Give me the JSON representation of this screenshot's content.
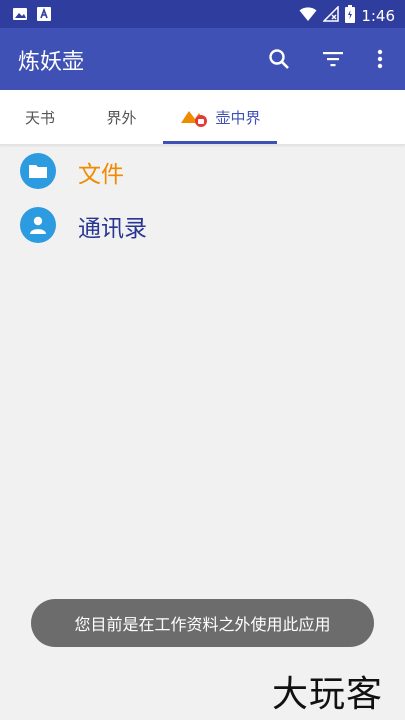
{
  "status_bar": {
    "time": "1:46",
    "left_icons": [
      "gallery-icon",
      "font-a-icon"
    ],
    "right_icons": [
      "wifi-icon",
      "no-signal-icon",
      "battery-icon"
    ]
  },
  "app_bar": {
    "title": "炼妖壶",
    "actions": [
      "search-icon",
      "filter-icon",
      "more-vert-icon"
    ],
    "color": "#3f51b5"
  },
  "tabs": {
    "items": [
      {
        "label": "天书"
      },
      {
        "label": "界外"
      },
      {
        "label": "壶中界"
      }
    ],
    "active_index": 2
  },
  "list": {
    "items": [
      {
        "label": "文件",
        "icon": "folder-icon",
        "color": "#f08a00"
      },
      {
        "label": "通讯录",
        "icon": "person-icon",
        "color": "#283593"
      }
    ]
  },
  "toast": {
    "text": "您目前是在工作资料之外使用此应用"
  },
  "watermark": {
    "text": "大玩客"
  }
}
